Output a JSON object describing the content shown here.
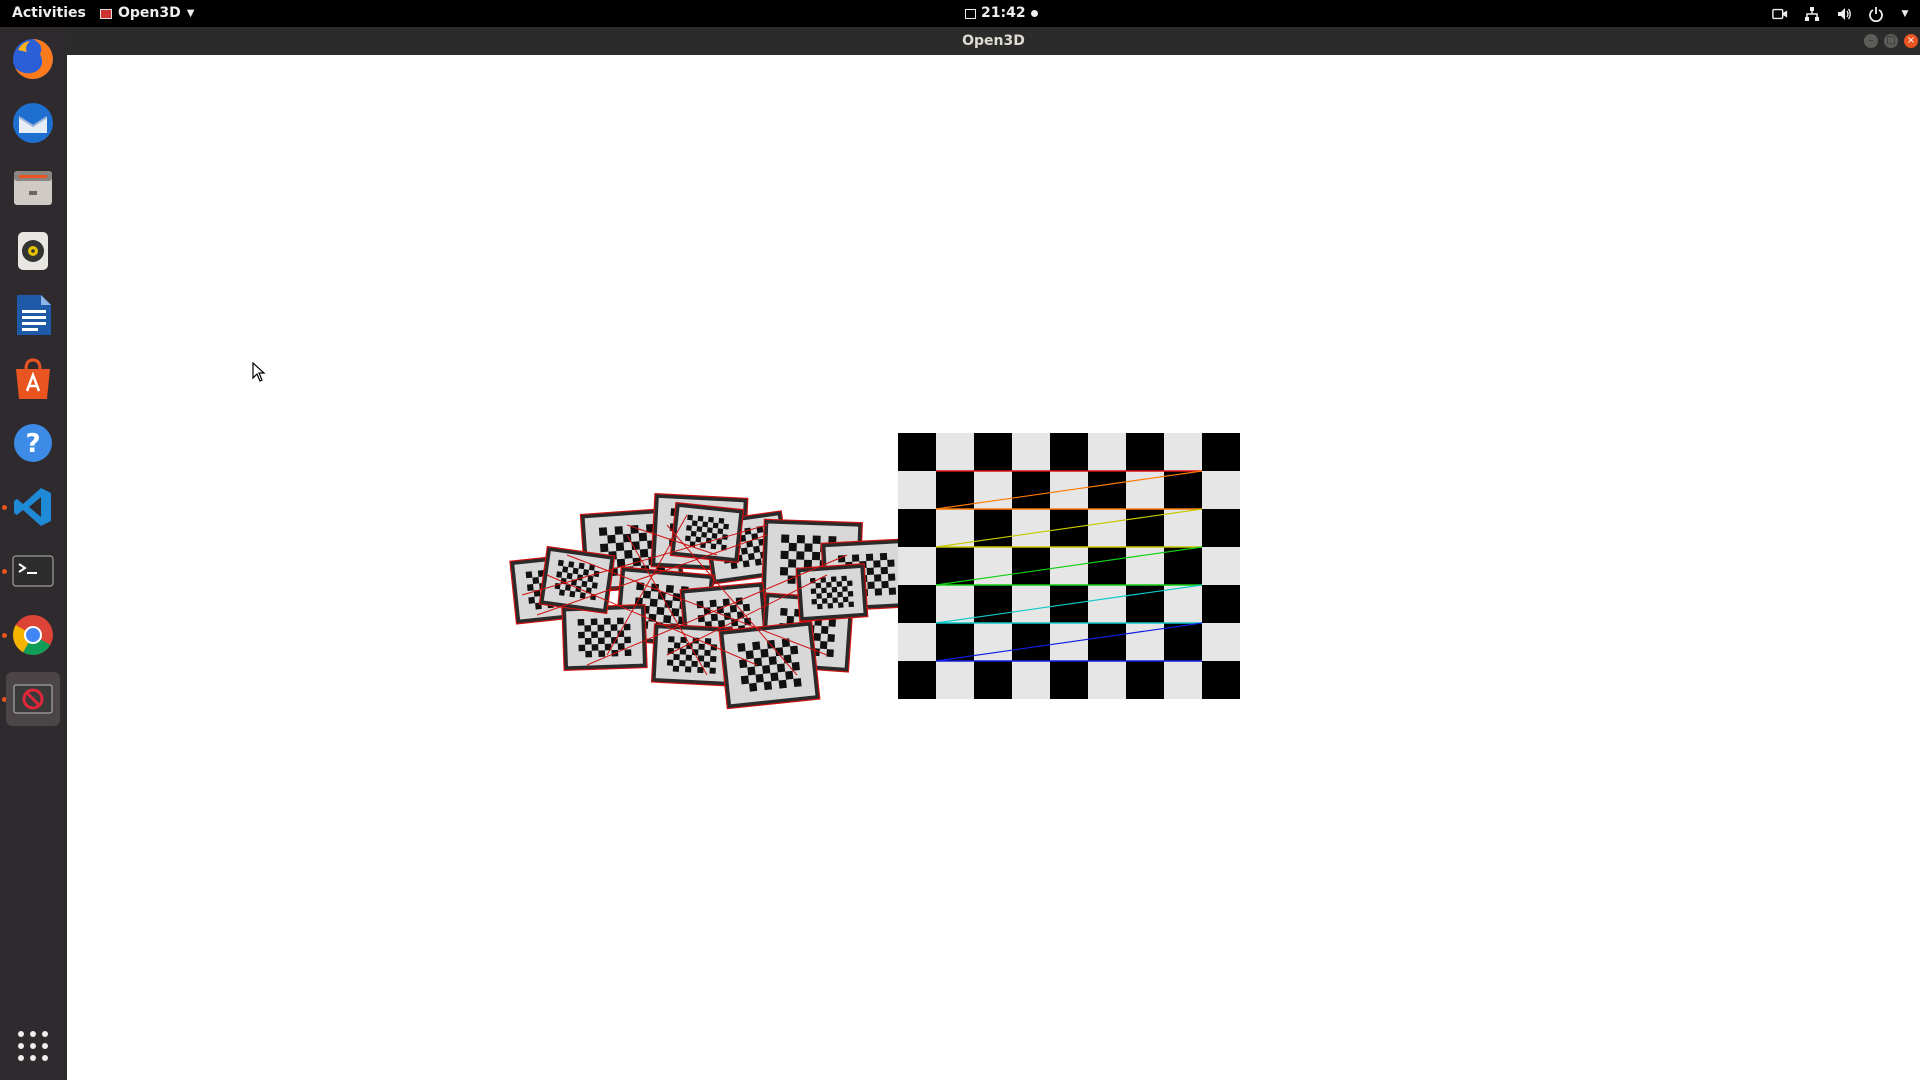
{
  "topbar": {
    "activities": "Activities",
    "app_name": "Open3D",
    "clock": "21:42"
  },
  "window": {
    "title": "Open3D"
  },
  "dock": {
    "items": [
      {
        "name": "firefox"
      },
      {
        "name": "thunderbird"
      },
      {
        "name": "files"
      },
      {
        "name": "rhythmbox"
      },
      {
        "name": "libreoffice-writer"
      },
      {
        "name": "software-center"
      },
      {
        "name": "help"
      },
      {
        "name": "vscode"
      },
      {
        "name": "terminal"
      },
      {
        "name": "chrome"
      },
      {
        "name": "open3d"
      },
      {
        "name": "show-applications"
      }
    ]
  },
  "colors": {
    "topbar": "#000000",
    "dock": "#2f2a2d",
    "titlebar": "#2b2b2b",
    "accent": "#e95420"
  }
}
